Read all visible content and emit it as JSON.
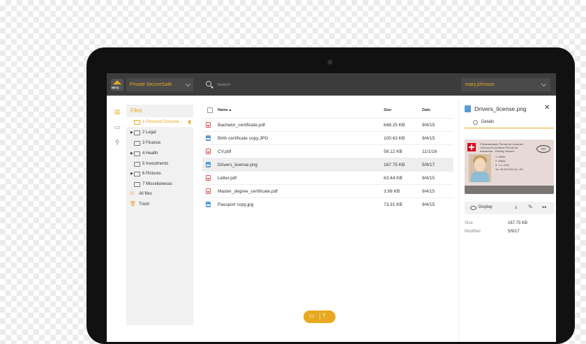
{
  "colors": {
    "accent": "#e8a920",
    "topbar": "#3c3c3c",
    "tree_bg": "#f1f1f1"
  },
  "topbar": {
    "logo_text": "BETA",
    "safe_selector": "Private SecureSafe",
    "search_placeholder": "Search",
    "user_selector": "mary.johnson"
  },
  "rail": {
    "icons": [
      "files-icon",
      "inbox-icon",
      "keys-icon"
    ]
  },
  "tree": {
    "title": "Files",
    "items": [
      {
        "label": "1 Personal Docume...",
        "expandable": false,
        "active": true
      },
      {
        "label": "2 Legal",
        "expandable": true
      },
      {
        "label": "3 Finance",
        "expandable": false
      },
      {
        "label": "4 Health",
        "expandable": true
      },
      {
        "label": "5 Investments",
        "expandable": false
      },
      {
        "label": "6 Pictures",
        "expandable": true
      },
      {
        "label": "7 Miscellaneous",
        "expandable": false
      }
    ],
    "all_files": "All files",
    "trash": "Trash"
  },
  "list": {
    "headers": {
      "name": "Name ▴",
      "size": "Size",
      "date": "Date"
    },
    "rows": [
      {
        "name": "Bachelor_certificate.pdf",
        "type": "pdf",
        "size": "648.25 KB",
        "date": "9/4/15"
      },
      {
        "name": "Birth certificate copy.JPG",
        "type": "img",
        "size": "100.63 KB",
        "date": "9/4/15"
      },
      {
        "name": "CV.pdf",
        "type": "pdf",
        "size": "58.12 KB",
        "date": "11/1/16"
      },
      {
        "name": "Drivers_license.png",
        "type": "img",
        "size": "167.75 KB",
        "date": "5/9/17",
        "selected": true
      },
      {
        "name": "Letter.pdf",
        "type": "pdf",
        "size": "63.44 KB",
        "date": "9/4/15"
      },
      {
        "name": "Master_degree_certificate.pdf",
        "type": "pdf",
        "size": "3.99 KB",
        "date": "9/4/15"
      },
      {
        "name": "Passport copy.jpg",
        "type": "img",
        "size": "73.31 KB",
        "date": "9/4/15"
      }
    ]
  },
  "detail": {
    "title": "Drivers_license.png",
    "tab": "Details",
    "card": {
      "header": "Führerausweis·Permis de conduire Licenza di condurre·Permis da manischar · Driving Licence",
      "country": "CH",
      "lines": [
        "1. Meier",
        "2. Maria",
        "3. 1.1.1979",
        "4a. 30.06.2015  4c. SG"
      ]
    },
    "display_label": "Display",
    "size_label": "Size",
    "size_value": "167.75 KB",
    "modified_label": "Modified",
    "modified_value": "5/9/17"
  }
}
